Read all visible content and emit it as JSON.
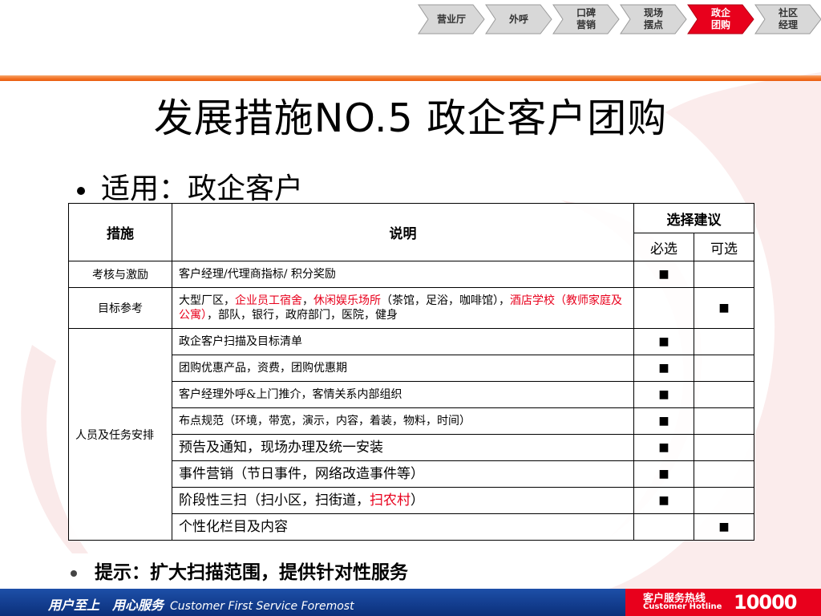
{
  "nav": {
    "tabs": [
      {
        "label": "营业厅",
        "active": false
      },
      {
        "label": "外呼",
        "active": false
      },
      {
        "label": "口碑\n营销",
        "active": false
      },
      {
        "label": "现场\n摆点",
        "active": false
      },
      {
        "label": "政企\n团购",
        "active": true
      },
      {
        "label": "社区\n经理",
        "active": false
      }
    ]
  },
  "title": "发展措施NO.5 政企客户团购",
  "bullet": "适用：政企客户",
  "table": {
    "headers": {
      "measure": "措施",
      "description": "说明",
      "selection": "选择建议",
      "required": "必选",
      "optional": "可选"
    },
    "mark": "■",
    "rows": {
      "r0": {
        "category": "考核与激励",
        "text": "客户经理/代理商指标/ 积分奖励"
      },
      "r1": {
        "category": "目标参考",
        "parts": [
          "大型厂区，",
          "企业员工宿舍",
          "，",
          "休闲娱乐场所",
          "（茶馆，足浴，咖啡馆），",
          "酒店学校（教师家庭及公寓）",
          "，部队，银行，政府部门，医院，健身"
        ]
      },
      "r2": {
        "category": "人员及任务安排",
        "text": "政企客户扫描及目标清单"
      },
      "r3": {
        "text": "团购优惠产品，资费，团购优惠期"
      },
      "r4": {
        "text": "客户经理外呼&上门推介，客情关系内部组织"
      },
      "r5": {
        "text": "布点规范（环境，带宽，演示，内容，着装，物料，时间）"
      },
      "r6": {
        "text": "预告及通知，现场办理及统一安装"
      },
      "r7": {
        "text": "事件营销（节日事件，网络改造事件等）"
      },
      "r8": {
        "parts": [
          "阶段性三扫（扫小区，扫街道，",
          "扫农村",
          "）"
        ]
      },
      "r9": {
        "text": "个性化栏目及内容"
      }
    }
  },
  "tip": "提示：扩大扫描范围，提供针对性服务",
  "footer": {
    "slogan_zh": "用户至上　用心服务",
    "slogan_en": "Customer First Service Foremost",
    "hotline_zh": "客户服务热线",
    "hotline_en": "Customer Hotline",
    "hotline_number": "10000"
  },
  "colors": {
    "accent_orange": "#f36f21",
    "highlight_red": "#e8001c",
    "footer_blue": "#0b2f7a"
  }
}
